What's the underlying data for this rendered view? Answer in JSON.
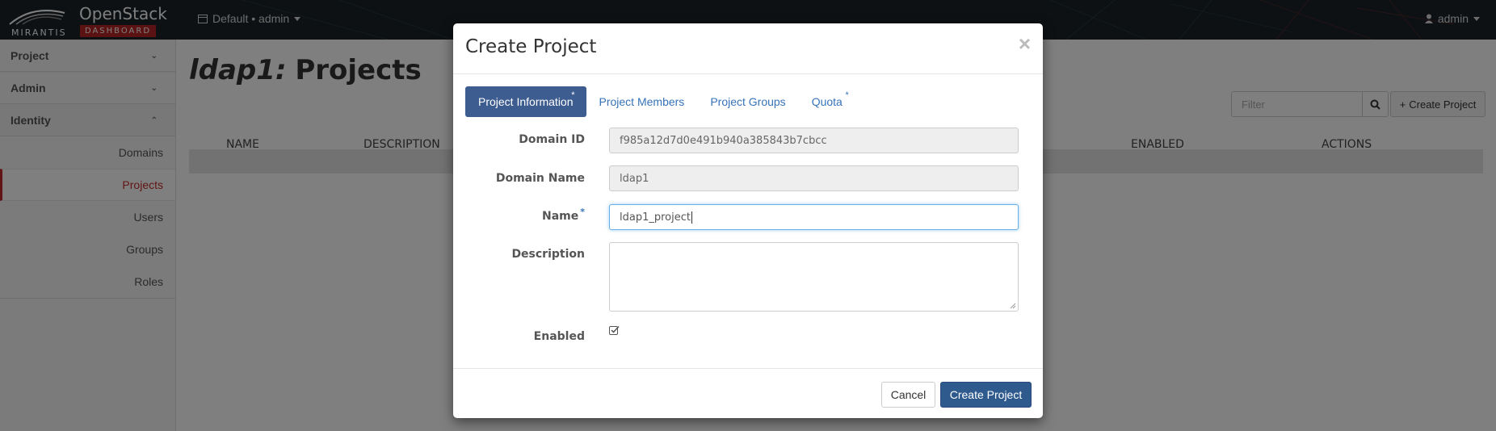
{
  "navbar": {
    "brand": {
      "company": "MIRANTIS",
      "product": "OpenStack",
      "sub": "DASHBOARD"
    },
    "context_label": "Default • admin",
    "user_label": "admin"
  },
  "sidebar": {
    "sections": [
      {
        "label": "Project",
        "chevron": "chevron-down"
      },
      {
        "label": "Admin",
        "chevron": "chevron-down"
      },
      {
        "label": "Identity",
        "chevron": "chevron-up"
      }
    ],
    "identity_items": [
      {
        "label": "Domains",
        "active": false
      },
      {
        "label": "Projects",
        "active": true
      },
      {
        "label": "Users",
        "active": false
      },
      {
        "label": "Groups",
        "active": false
      },
      {
        "label": "Roles",
        "active": false
      }
    ]
  },
  "page": {
    "title_domain": "ldap1:",
    "title_rest": "Projects",
    "filter_placeholder": "Filter",
    "create_button": "Create Project",
    "columns": [
      "NAME",
      "DESCRIPTION",
      "ENABLED",
      "ACTIONS"
    ]
  },
  "modal": {
    "title": "Create Project",
    "close": "×",
    "tabs": [
      {
        "label": "Project Information",
        "required": true,
        "active": true
      },
      {
        "label": "Project Members",
        "required": false,
        "active": false
      },
      {
        "label": "Project Groups",
        "required": false,
        "active": false
      },
      {
        "label": "Quota",
        "required": true,
        "active": false
      }
    ],
    "fields": {
      "domain_id": {
        "label": "Domain ID",
        "value": "f985a12d7d0e491b940a385843b7cbcc"
      },
      "domain_name": {
        "label": "Domain Name",
        "value": "ldap1"
      },
      "name": {
        "label": "Name",
        "value": "ldap1_project",
        "required": true
      },
      "description": {
        "label": "Description",
        "value": ""
      },
      "enabled": {
        "label": "Enabled",
        "checked": true
      }
    },
    "required_marker": "*",
    "cancel_label": "Cancel",
    "submit_label": "Create Project"
  },
  "colors": {
    "accent": "#c62a2a",
    "primary": "#2e5a8e",
    "tab_active": "#3d5c8f",
    "link": "#3673b8"
  }
}
